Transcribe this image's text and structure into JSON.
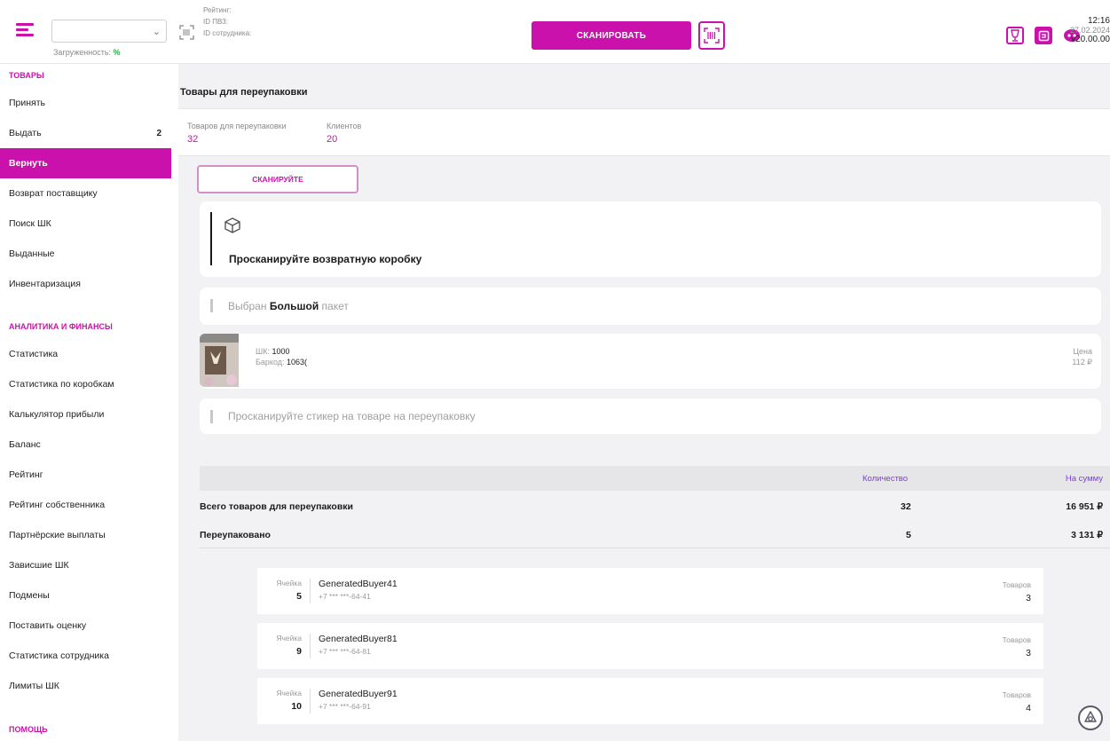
{
  "topbar": {
    "store_select_value": "",
    "load_label": "Загруженность:",
    "load_value": "%",
    "info": [
      "Рейтинг:",
      "ID ПВЗ:",
      "ID сотрудника:"
    ],
    "scan_button": "СКАНИРОВАТЬ",
    "clock_time": "12:16",
    "clock_date": "27.02.2024",
    "version": "v20.00.00"
  },
  "sidebar": {
    "sections": [
      {
        "title": "ТОВАРЫ",
        "items": [
          {
            "label": "Принять",
            "count": ""
          },
          {
            "label": "Выдать",
            "count": "2"
          },
          {
            "label": "Вернуть",
            "count": "",
            "active": true
          },
          {
            "label": "Возврат поставщику",
            "count": ""
          },
          {
            "label": "Поиск ШК",
            "count": ""
          },
          {
            "label": "Выданные",
            "count": ""
          },
          {
            "label": "Инвентаризация",
            "count": ""
          }
        ]
      },
      {
        "title": "АНАЛИТИКА И ФИНАНСЫ",
        "items": [
          {
            "label": "Статистика"
          },
          {
            "label": "Статистика по коробкам"
          },
          {
            "label": "Калькулятор прибыли"
          },
          {
            "label": "Баланс"
          },
          {
            "label": "Рейтинг"
          },
          {
            "label": "Рейтинг собственника"
          },
          {
            "label": "Партнёрские выплаты"
          },
          {
            "label": "Зависшие ШК"
          },
          {
            "label": "Подмены"
          },
          {
            "label": "Поставить оценку"
          },
          {
            "label": "Статистика сотрудника"
          },
          {
            "label": "Лимиты ШК"
          }
        ]
      },
      {
        "title": "ПОМОЩЬ",
        "items": []
      }
    ]
  },
  "main": {
    "title": "Товары для переупаковки",
    "stats": [
      {
        "label": "Товаров для переупаковки",
        "value": "32"
      },
      {
        "label": "Клиентов",
        "value": "20"
      }
    ],
    "scan_input_label": "СКАНИРУЙТЕ",
    "box_prompt": "Просканируйте возвратную коробку",
    "bag_prefix": "Выбран",
    "bag_size": "Большой",
    "bag_suffix": "пакет",
    "item": {
      "sk_label": "ШК:",
      "sk_value": "1000",
      "barcode_label": "Баркод:",
      "barcode_value": "1063(",
      "price_label": "Цена",
      "price_value": "112 ₽"
    },
    "sticker_prompt": "Просканируйте стикер на товаре на переупаковку",
    "summary": {
      "col_qty": "Количество",
      "col_sum": "На сумму",
      "rows": [
        {
          "label": "Всего товаров для переупаковки",
          "qty": "32",
          "sum": "16 951 ₽"
        },
        {
          "label": "Переупаковано",
          "qty": "5",
          "sum": "3 131 ₽"
        }
      ]
    },
    "clients": [
      {
        "cell_label": "Ячейка",
        "cell": "5",
        "name": "GeneratedBuyer41",
        "phone": "+7 *** ***-64-41",
        "goods_label": "Товаров",
        "goods": "3"
      },
      {
        "cell_label": "Ячейка",
        "cell": "9",
        "name": "GeneratedBuyer81",
        "phone": "+7 *** ***-64-81",
        "goods_label": "Товаров",
        "goods": "3"
      },
      {
        "cell_label": "Ячейка",
        "cell": "10",
        "name": "GeneratedBuyer91",
        "phone": "+7 *** ***-64-91",
        "goods_label": "Товаров",
        "goods": "4"
      }
    ]
  },
  "colors": {
    "accent": "#cb11ab",
    "purple_text": "#7b3fd6",
    "bg": "#f2f2f4"
  },
  "icons": [
    "hamburger-icon",
    "barcode-icon",
    "scan-code-icon",
    "wine-glass-icon",
    "wallet-icon",
    "chat-icon",
    "box-icon",
    "help-icon"
  ]
}
